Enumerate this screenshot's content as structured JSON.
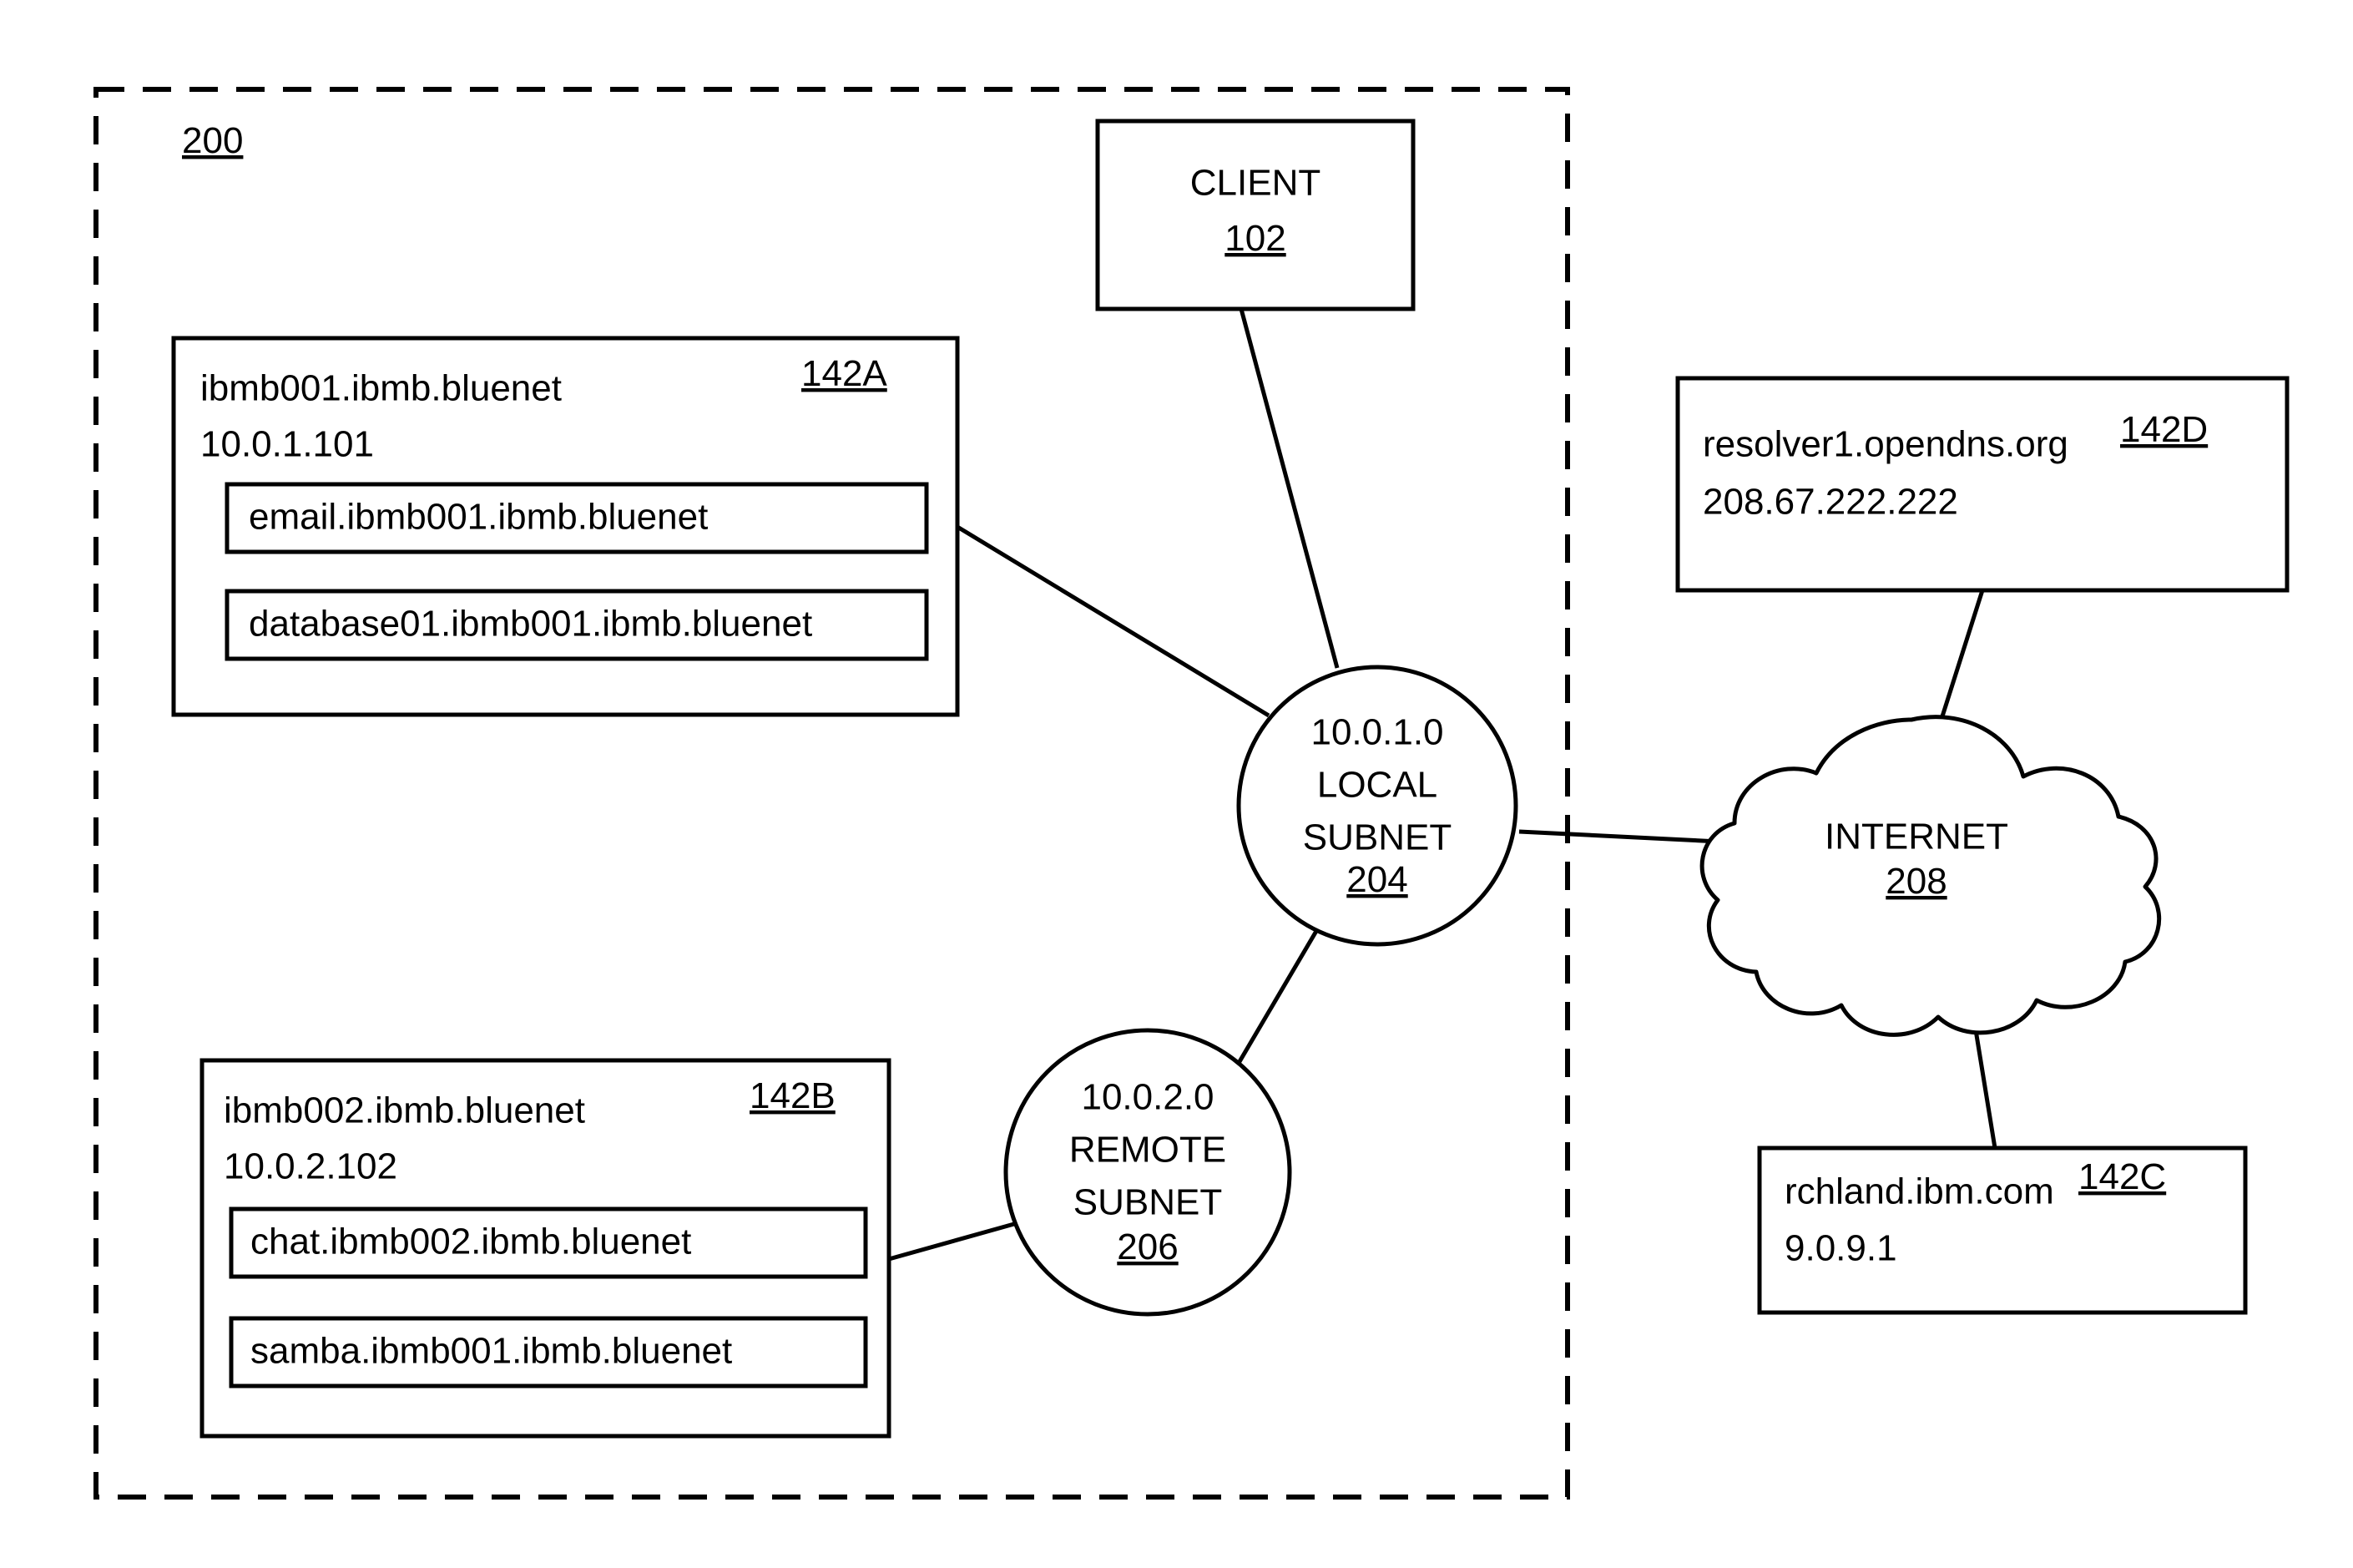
{
  "figure": {
    "boundary_label": "200",
    "title_ref": "200"
  },
  "client": {
    "label": "CLIENT",
    "ref": "102"
  },
  "hosts": [
    {
      "id": "142A",
      "hostname": "ibmb001.ibmb.bluenet",
      "ip": "10.0.1.101",
      "services": [
        "email.ibmb001.ibmb.bluenet",
        "database01.ibmb001.ibmb.bluenet"
      ]
    },
    {
      "id": "142B",
      "hostname": "ibmb002.ibmb.bluenet",
      "ip": "10.0.2.102",
      "services": [
        "chat.ibmb002.ibmb.bluenet",
        "samba.ibmb001.ibmb.bluenet"
      ]
    }
  ],
  "external_hosts": [
    {
      "id": "142D",
      "hostname": "resolver1.opendns.org",
      "ip": "208.67.222.222"
    },
    {
      "id": "142C",
      "hostname": "rchland.ibm.com",
      "ip": "9.0.9.1"
    }
  ],
  "subnets": [
    {
      "id": "204",
      "network": "10.0.1.0",
      "line1": "LOCAL",
      "line2": "SUBNET",
      "ref": "204"
    },
    {
      "id": "206",
      "network": "10.0.2.0",
      "line1": "REMOTE",
      "line2": "SUBNET",
      "ref": "206"
    }
  ],
  "internet": {
    "label": "INTERNET",
    "ref": "208"
  },
  "colors": {
    "stroke": "#000000",
    "fill": "#ffffff"
  }
}
